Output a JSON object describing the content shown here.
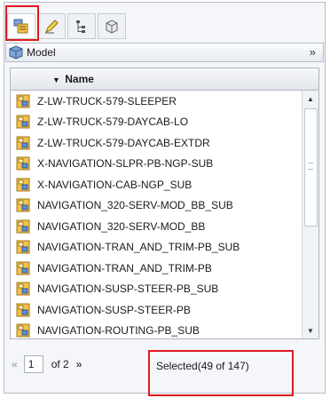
{
  "toolbar": {
    "buttons": [
      {
        "name": "model-tree-icon",
        "active": true
      },
      {
        "name": "edit-pencil-icon",
        "active": false
      },
      {
        "name": "structure-tree-icon",
        "active": false
      },
      {
        "name": "part-box-icon",
        "active": false
      }
    ]
  },
  "model_bar": {
    "label": "Model",
    "chevron": "»"
  },
  "grid": {
    "column_header": "Name",
    "sort_indicator": "▼",
    "rows": [
      "Z-LW-TRUCK-579-SLEEPER",
      "Z-LW-TRUCK-579-DAYCAB-LO",
      "Z-LW-TRUCK-579-DAYCAB-EXTDR",
      "X-NAVIGATION-SLPR-PB-NGP-SUB",
      "X-NAVIGATION-CAB-NGP_SUB",
      "NAVIGATION_320-SERV-MOD_BB_SUB",
      "NAVIGATION_320-SERV-MOD_BB",
      "NAVIGATION-TRAN_AND_TRIM-PB_SUB",
      "NAVIGATION-TRAN_AND_TRIM-PB",
      "NAVIGATION-SUSP-STEER-PB_SUB",
      "NAVIGATION-SUSP-STEER-PB",
      "NAVIGATION-ROUTING-PB_SUB"
    ]
  },
  "pagination": {
    "prev": "«",
    "current_page": "1",
    "of_label": "of 2",
    "next": "»",
    "selection_text": "Selected(49 of 147)"
  },
  "colors": {
    "highlight": "#e2181f",
    "assembly_icon": "#e0a92a"
  }
}
